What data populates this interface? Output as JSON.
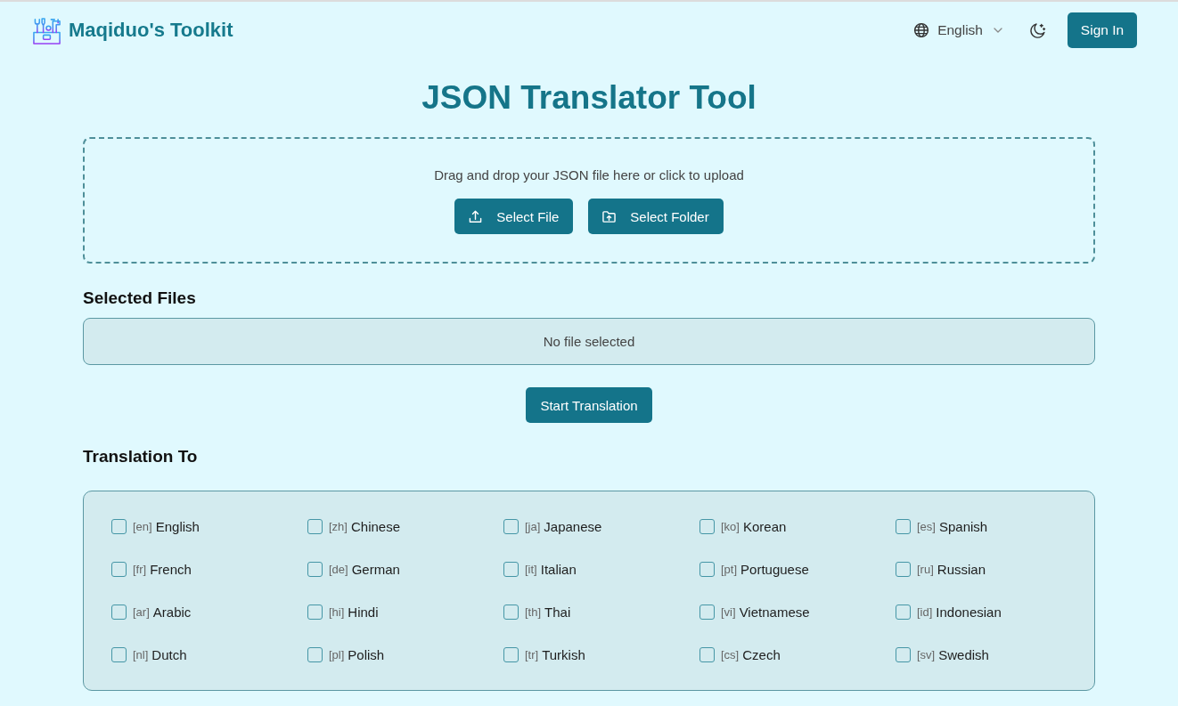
{
  "header": {
    "brand": "Maqiduo's Toolkit",
    "language": "English",
    "sign_in": "Sign In"
  },
  "page_title": "JSON Translator Tool",
  "upload": {
    "prompt": "Drag and drop your JSON file here or click to upload",
    "buttons": [
      {
        "kind": "file",
        "label": "Select File"
      },
      {
        "kind": "folder",
        "label": "Select Folder"
      }
    ]
  },
  "selected_files": {
    "heading": "Selected Files",
    "empty_message": "No file selected"
  },
  "start_button": "Start Translation",
  "translation_to": {
    "heading": "Translation To",
    "languages": [
      {
        "code": "[en]",
        "name": "English",
        "checked": false
      },
      {
        "code": "[zh]",
        "name": "Chinese",
        "checked": false
      },
      {
        "code": "[ja]",
        "name": "Japanese",
        "checked": false
      },
      {
        "code": "[ko]",
        "name": "Korean",
        "checked": false
      },
      {
        "code": "[es]",
        "name": "Spanish",
        "checked": false
      },
      {
        "code": "[fr]",
        "name": "French",
        "checked": false
      },
      {
        "code": "[de]",
        "name": "German",
        "checked": false
      },
      {
        "code": "[it]",
        "name": "Italian",
        "checked": false
      },
      {
        "code": "[pt]",
        "name": "Portuguese",
        "checked": false
      },
      {
        "code": "[ru]",
        "name": "Russian",
        "checked": false
      },
      {
        "code": "[ar]",
        "name": "Arabic",
        "checked": false
      },
      {
        "code": "[hi]",
        "name": "Hindi",
        "checked": false
      },
      {
        "code": "[th]",
        "name": "Thai",
        "checked": false
      },
      {
        "code": "[vi]",
        "name": "Vietnamese",
        "checked": false
      },
      {
        "code": "[id]",
        "name": "Indonesian",
        "checked": false
      },
      {
        "code": "[nl]",
        "name": "Dutch",
        "checked": false
      },
      {
        "code": "[pl]",
        "name": "Polish",
        "checked": false
      },
      {
        "code": "[tr]",
        "name": "Turkish",
        "checked": false
      },
      {
        "code": "[cs]",
        "name": "Czech",
        "checked": false
      },
      {
        "code": "[sv]",
        "name": "Swedish",
        "checked": false
      }
    ]
  }
}
